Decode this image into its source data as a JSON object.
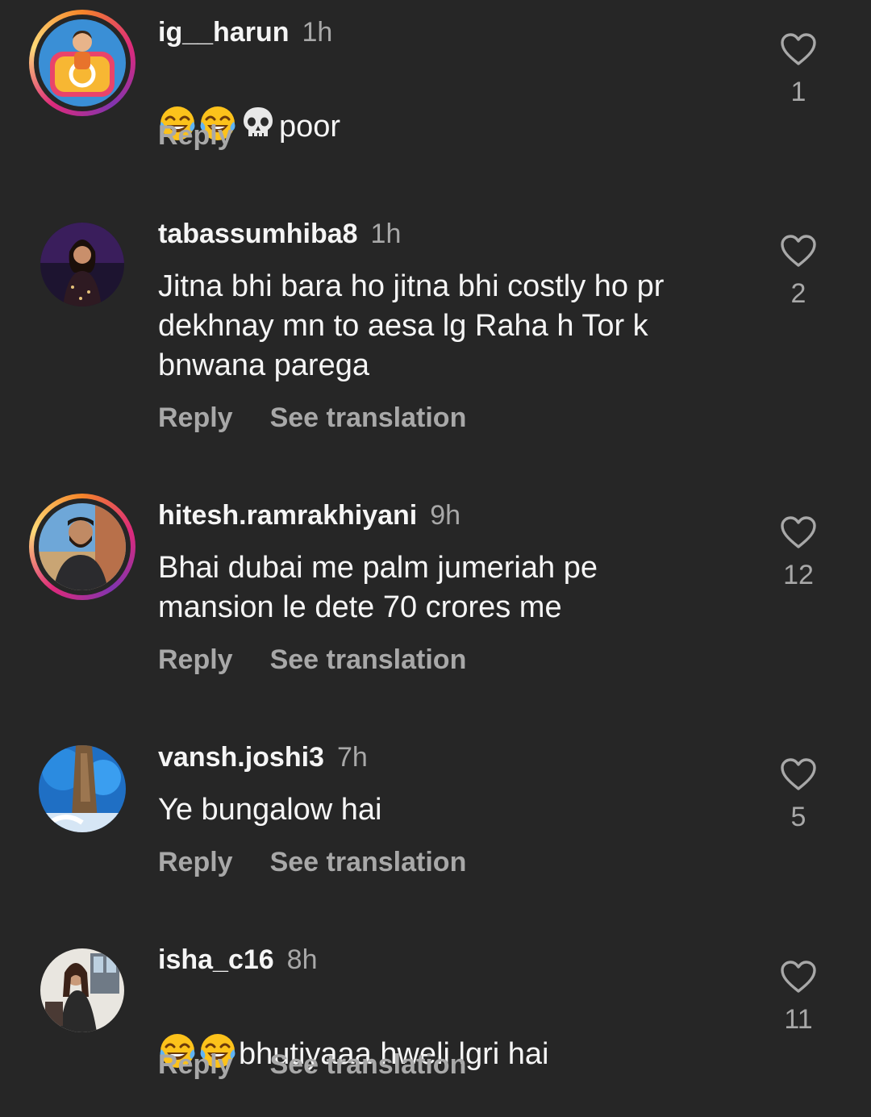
{
  "comments": [
    {
      "username": "ig__harun",
      "time": "1h",
      "emojis": [
        "face-with-tears-of-joy-icon",
        "face-with-tears-of-joy-icon",
        "skull-icon"
      ],
      "text": "poor",
      "reply_label": "Reply",
      "likes": "1"
    },
    {
      "username": "tabassumhiba8",
      "time": "1h",
      "text": "Jitna bhi bara ho jitna bhi costly ho pr\ndekhnay mn to aesa lg Raha h Tor k\nbnwana parega",
      "reply_label": "Reply",
      "translate_label": "See translation",
      "likes": "2"
    },
    {
      "username": "hitesh.ramrakhiyani",
      "time": "9h",
      "text": "Bhai dubai me palm jumeriah pe\nmansion le dete 70 crores me",
      "reply_label": "Reply",
      "translate_label": "See translation",
      "likes": "12"
    },
    {
      "username": "vansh.joshi3",
      "time": "7h",
      "text": "Ye bungalow hai",
      "reply_label": "Reply",
      "translate_label": "See translation",
      "likes": "5"
    },
    {
      "username": "isha_c16",
      "time": "8h",
      "emojis": [
        "face-with-tears-of-joy-icon",
        "face-with-tears-of-joy-icon"
      ],
      "text": "bhutiyaaa hweli lgri hai",
      "reply_label": "Reply",
      "translate_label": "See translation",
      "likes": "11"
    }
  ],
  "colors": {
    "background": "#262626",
    "primary_text": "#f5f5f5",
    "secondary_text": "#a8a8a8",
    "story_ring": "#dd2a7b"
  }
}
